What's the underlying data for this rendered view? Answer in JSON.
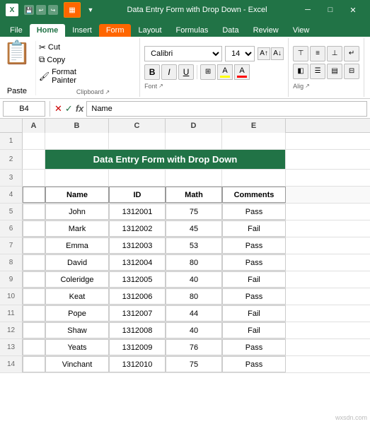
{
  "titlebar": {
    "app_name": "Microsoft Excel",
    "file_name": "Data Entry Form with Drop Down - Excel"
  },
  "ribbon": {
    "tabs": [
      "File",
      "Home",
      "Insert",
      "Form",
      "Layout",
      "Formulas",
      "Data",
      "Review",
      "View"
    ],
    "active_tab": "Home",
    "highlighted_tab": "Form",
    "clipboard": {
      "paste_label": "Paste",
      "cut_label": "Cut",
      "copy_label": "Copy",
      "format_painter_label": "Format Painter",
      "group_label": "Clipboard"
    },
    "font": {
      "font_name": "Calibri",
      "font_size": "14",
      "bold": "B",
      "italic": "I",
      "underline": "U",
      "group_label": "Font"
    },
    "alignment": {
      "group_label": "Alig"
    }
  },
  "formula_bar": {
    "cell_ref": "B4",
    "formula_content": "Name"
  },
  "spreadsheet": {
    "col_headers": [
      "A",
      "B",
      "C",
      "D",
      "E"
    ],
    "title_row": {
      "row_num": "2",
      "title": "Data Entry Form with Drop Down"
    },
    "header_row": {
      "row_num": "4",
      "cols": [
        "Name",
        "ID",
        "Math",
        "Comments"
      ]
    },
    "data_rows": [
      {
        "row_num": "5",
        "name": "John",
        "id": "1312001",
        "math": "75",
        "comments": "Pass"
      },
      {
        "row_num": "6",
        "name": "Mark",
        "id": "1312002",
        "math": "45",
        "comments": "Fail"
      },
      {
        "row_num": "7",
        "name": "Emma",
        "id": "1312003",
        "math": "53",
        "comments": "Pass"
      },
      {
        "row_num": "8",
        "name": "David",
        "id": "1312004",
        "math": "80",
        "comments": "Pass"
      },
      {
        "row_num": "9",
        "name": "Coleridge",
        "id": "1312005",
        "math": "40",
        "comments": "Fail"
      },
      {
        "row_num": "10",
        "name": "Keat",
        "id": "1312006",
        "math": "80",
        "comments": "Pass"
      },
      {
        "row_num": "11",
        "name": "Pope",
        "id": "1312007",
        "math": "44",
        "comments": "Fail"
      },
      {
        "row_num": "12",
        "name": "Shaw",
        "id": "1312008",
        "math": "40",
        "comments": "Fail"
      },
      {
        "row_num": "13",
        "name": "Yeats",
        "id": "1312009",
        "math": "76",
        "comments": "Pass"
      },
      {
        "row_num": "14",
        "name": "Vinchant",
        "id": "1312010",
        "math": "75",
        "comments": "Pass"
      }
    ]
  },
  "watermark": "wxsdn.com"
}
